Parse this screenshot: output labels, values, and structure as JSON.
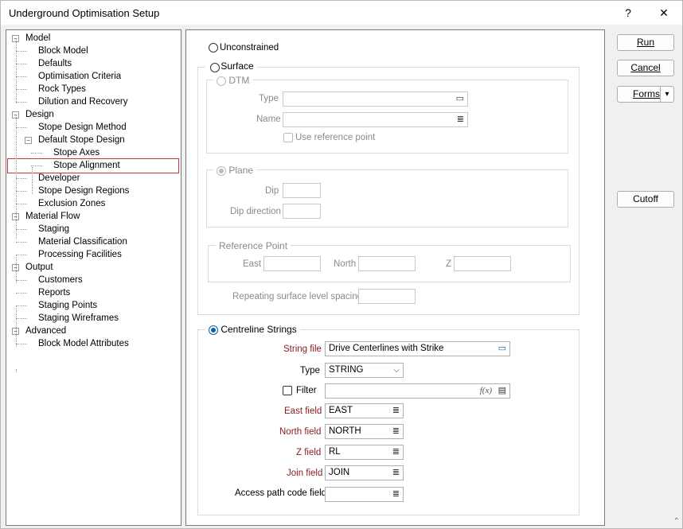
{
  "window": {
    "title": "Underground Optimisation Setup",
    "help_label": "?",
    "close_label": "✕"
  },
  "tree": [
    {
      "label": "Model",
      "toggle": "−"
    },
    {
      "label": "Block Model"
    },
    {
      "label": "Defaults"
    },
    {
      "label": "Optimisation Criteria"
    },
    {
      "label": "Rock Types"
    },
    {
      "label": "Dilution and Recovery"
    },
    {
      "label": "Design",
      "toggle": "−"
    },
    {
      "label": "Stope Design Method"
    },
    {
      "label": "Default Stope Design",
      "toggle": "−"
    },
    {
      "label": "Stope Axes"
    },
    {
      "label": "Stope Alignment",
      "selected": true
    },
    {
      "label": "Developer"
    },
    {
      "label": "Stope Design Regions"
    },
    {
      "label": "Exclusion Zones"
    },
    {
      "label": "Material Flow",
      "toggle": "−"
    },
    {
      "label": "Staging"
    },
    {
      "label": "Material Classification"
    },
    {
      "label": "Processing Facilities"
    },
    {
      "label": "Output",
      "toggle": "−"
    },
    {
      "label": "Customers"
    },
    {
      "label": "Reports"
    },
    {
      "label": "Staging Points"
    },
    {
      "label": "Staging Wireframes"
    },
    {
      "label": "Advanced",
      "toggle": "−"
    },
    {
      "label": "Block Model Attributes"
    }
  ],
  "form": {
    "unconstrained_label": "Unconstrained",
    "surface_label": "Surface",
    "dtm_label": "DTM",
    "type_label": "Type",
    "name_label": "Name",
    "use_ref_label": "Use reference point",
    "plane_label": "Plane",
    "dip_label": "Dip",
    "dip_dir_label": "Dip direction",
    "ref_point_label": "Reference Point",
    "east_label": "East",
    "north_label": "North",
    "z_label": "Z",
    "repeat_label": "Repeating surface level spacing",
    "centreline_label": "Centreline Strings",
    "string_file_label": "String file",
    "string_file_value": "Drive Centerlines with Strike",
    "cl_type_label": "Type",
    "cl_type_value": "STRING",
    "filter_label": "Filter",
    "filter_fx": "f(x)",
    "east_field_label": "East field",
    "east_field_value": "EAST",
    "north_field_label": "North field",
    "north_field_value": "NORTH",
    "z_field_label": "Z field",
    "z_field_value": "RL",
    "join_field_label": "Join field",
    "join_field_value": "JOIN",
    "access_label": "Access path code field",
    "access_value": ""
  },
  "buttons": {
    "run": "Run",
    "cancel": "Cancel",
    "forms": "Forms",
    "forms_arrow": "▾",
    "cutoff": "Cutoff"
  },
  "colors": {
    "required_label": "#8b1a1a",
    "accent": "#0063b1",
    "selection_border": "#d13438"
  }
}
